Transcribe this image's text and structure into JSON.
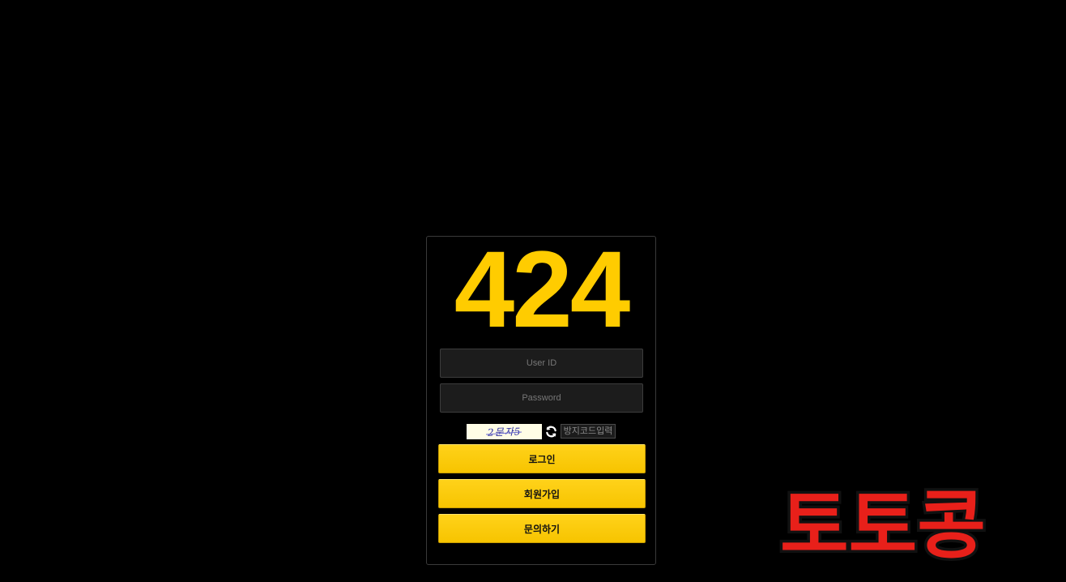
{
  "site": {
    "logo_text": "424",
    "watermark_text": "토토콩"
  },
  "login": {
    "user_id_placeholder": "User ID",
    "password_placeholder": "Password",
    "captcha_text": "2문자5",
    "captcha_input_placeholder": "방지코드입력",
    "login_label": "로그인",
    "join_label": "회원가입",
    "inquiry_label": "문의하기"
  },
  "colors": {
    "accent": "#ffcc00",
    "background": "#000000",
    "watermark_fill": "#e8201a"
  },
  "icons": {
    "refresh": "refresh-icon"
  }
}
